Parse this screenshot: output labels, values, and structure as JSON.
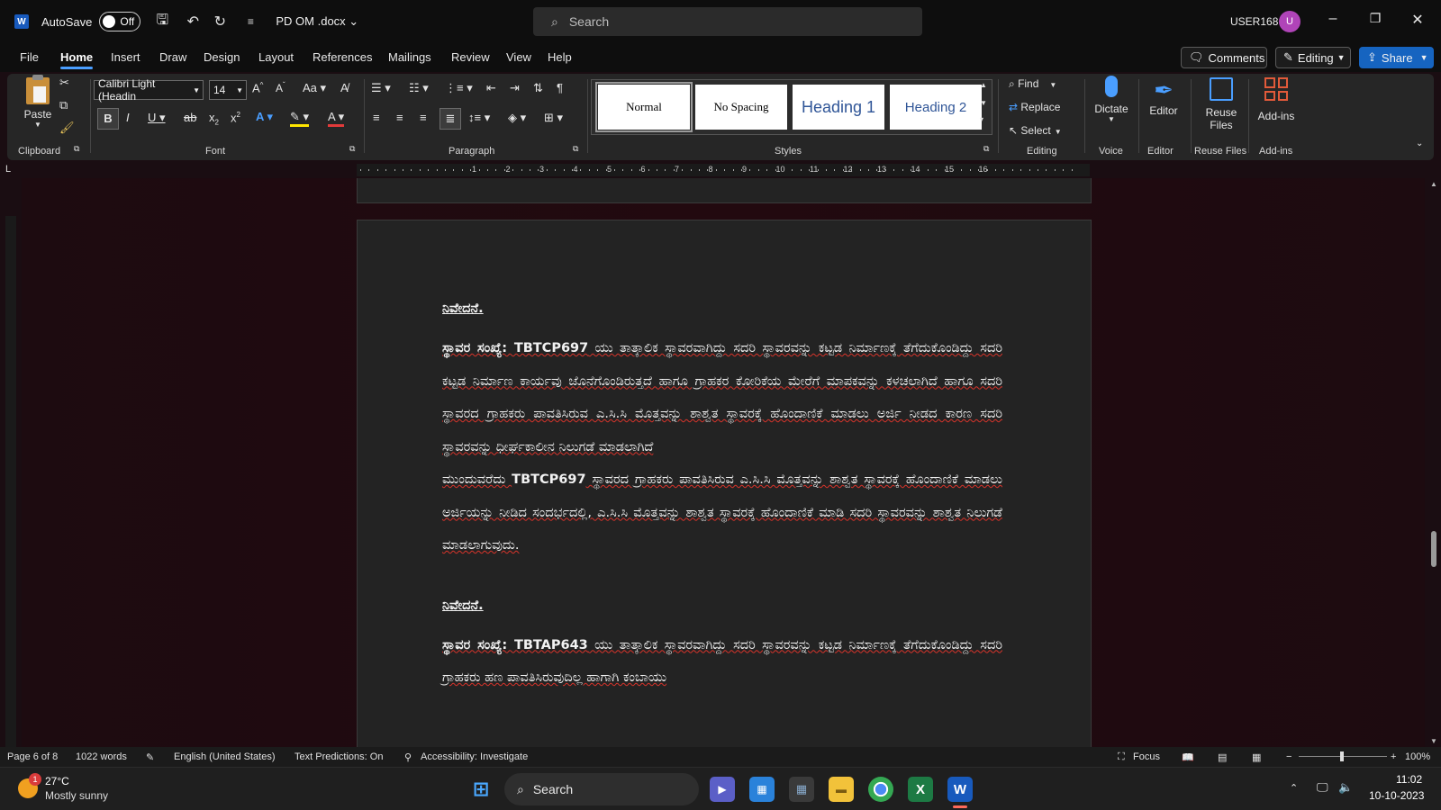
{
  "titlebar": {
    "autosave_label": "AutoSave",
    "autosave_state": "Off",
    "doc_title": "PD OM .docx",
    "search_placeholder": "Search",
    "user_name": "USER168",
    "avatar_initial": "U"
  },
  "menu": {
    "tabs": [
      "File",
      "Home",
      "Insert",
      "Draw",
      "Design",
      "Layout",
      "References",
      "Mailings",
      "Review",
      "View",
      "Help"
    ],
    "active_tab": "Home",
    "comments_label": "Comments",
    "editing_label": "Editing",
    "share_label": "Share"
  },
  "ribbon": {
    "clipboard": {
      "paste_label": "Paste",
      "group": "Clipboard"
    },
    "font": {
      "name": "Calibri Light (Headin",
      "size": "14",
      "group": "Font"
    },
    "paragraph": {
      "group": "Paragraph"
    },
    "styles": {
      "items": [
        "Normal",
        "No Spacing",
        "Heading 1",
        "Heading 2"
      ],
      "group": "Styles"
    },
    "editing": {
      "find": "Find",
      "replace": "Replace",
      "select": "Select",
      "group": "Editing"
    },
    "voice": {
      "dictate": "Dictate",
      "group": "Voice"
    },
    "editor": {
      "label": "Editor",
      "group": "Editor"
    },
    "reuse": {
      "label_line1": "Reuse",
      "label_line2": "Files",
      "group": "Reuse Files"
    },
    "addins": {
      "label": "Add-ins",
      "group": "Add-ins"
    }
  },
  "document": {
    "heading1": "ನಿವೇದನೆ.",
    "para1_bold": "ಸ್ಥಾವರ ಸಂಖ್ಯೆ: TBTCP697",
    "para1_text": " ಯು ತಾತ್ಕಾಲಿಕ ಸ್ಥಾವರವಾಗಿದ್ದು ಸದರಿ ಸ್ಥಾವರವನ್ನು ಕಟ್ಟಡ ನಿರ್ಮಾಣಕ್ಕೆ ತೆಗೆದುಕೊಂಡಿದ್ದು ಸದರಿ ಕಟ್ಟಡ ನಿರ್ಮಾಣ ಕಾರ್ಯವು ಜೊನೆಗೊಂಡಿರುತ್ತದೆ ಹಾಗೂ ಗ್ರಾಹಕರ ಕೋರಿಕೆಯ ಮೇರೆಗೆ ಮಾಪಕವನ್ನು ಕಳಚಲಾಗಿದೆ ಹಾಗೂ ಸದರಿ ಸ್ಥಾವರದ ಗ್ರಾಹಕರು ಪಾವತಿಸಿರುವ ಎ.ಸಿ.ಸಿ ಮೊತ್ತವನ್ನು ಶಾಶ್ವತ ಸ್ಥಾವರಕ್ಕೆ ಹೊಂದಾಣಿಕೆ ಮಾಡಲು ಅರ್ಜಿ ನೀಡದ ಕಾರಣ ಸದರಿ ಸ್ಥಾವರವನ್ನು ಧೀರ್ಘಕಾಲೀನ ನಿಲುಗಡೆ ಮಾಡಲಾಗಿದೆ",
    "para2_start": "ಮುಂದುವರೆದು ",
    "para2_bold": "TBTCP697",
    "para2_text": " ಸ್ಥಾವರದ ಗ್ರಾಹಕರು ಪಾವತಿಸಿರುವ ಎ.ಸಿ.ಸಿ ಮೊತ್ತವನ್ನು ಶಾಶ್ವತ ಸ್ಥಾವರಕ್ಕೆ ಹೊಂದಾಣಿಕೆ ಮಾಡಲು ಅರ್ಜಿಯನ್ನು ನೀಡಿದ ಸಂದರ್ಭದಲ್ಲಿ, ಎ.ಸಿ.ಸಿ ಮೊತ್ತವನ್ನು ಶಾಶ್ವತ ಸ್ಥಾವರಕ್ಕೆ ಹೊಂದಾಣಿಕೆ ಮಾಡಿ ಸದರಿ ಸ್ಥಾವರವನ್ನು ಶಾಶ್ವತ ನಿಲುಗಡೆ ಮಾಡಲಾಗುವುದು.",
    "heading2": "ನಿವೇದನೆ.",
    "para3_bold": "ಸ್ಥಾವರ ಸಂಖ್ಯೆ: TBTAP643",
    "para3_text": " ಯು ತಾತ್ಕಾಲಿಕ ಸ್ಥಾವರವಾಗಿದ್ದು ಸದರಿ ಸ್ಥಾವರವನ್ನು ಕಟ್ಟಡ ನಿರ್ಮಾಣಕ್ಕೆ ತೆಗೆದುಕೊಂಡಿದ್ದು ಸದರಿ ಗ್ರಾಹಕರು ಹಣ ಪಾವತಿಸಿರುವುದಿಲ್ಲ ಹಾಗಾಗಿ ಕಂಬಾಯು"
  },
  "ruler": {
    "numbers": [
      "1",
      "2",
      "3",
      "4",
      "5",
      "6",
      "7",
      "8",
      "9",
      "10",
      "11",
      "12",
      "13",
      "14",
      "15",
      "16"
    ]
  },
  "statusbar": {
    "page": "Page 6 of 8",
    "words": "1022 words",
    "language": "English (United States)",
    "predictions": "Text Predictions: On",
    "accessibility": "Accessibility: Investigate",
    "focus": "Focus",
    "zoom": "100%"
  },
  "taskbar": {
    "weather_temp": "27°C",
    "weather_desc": "Mostly sunny",
    "weather_badge": "1",
    "search_label": "Search",
    "time": "11:02",
    "date": "10-10-2023"
  },
  "colors": {
    "accent": "#4a9eff",
    "word_blue": "#185abd",
    "share": "#1664c0",
    "avatar": "#b044b8"
  }
}
